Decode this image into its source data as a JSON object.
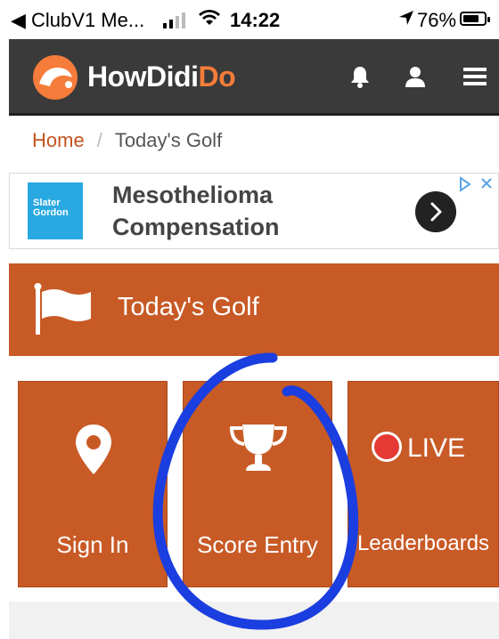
{
  "statusbar": {
    "back_app": "◀ ClubV1 Me...",
    "time": "14:22",
    "battery_percent": "76%",
    "battery_level": 0.76
  },
  "navbar": {
    "brand_left": "HowDidi",
    "brand_right": "Do"
  },
  "breadcrumb": {
    "home": "Home",
    "separator": "/",
    "current": "Today's Golf"
  },
  "ad": {
    "advertiser_logo_text": "Slater Gordon",
    "title": "Mesothelioma Compensation"
  },
  "section": {
    "title": "Today's Golf"
  },
  "tiles": [
    {
      "label": "Sign In",
      "icon": "map-pin-icon"
    },
    {
      "label": "Score Entry",
      "icon": "trophy-icon"
    },
    {
      "label": "Leaderboards",
      "icon": "live-indicator",
      "badge": "LIVE"
    }
  ],
  "colors": {
    "brand_orange": "#c85a26",
    "navbar": "#3a3a3a",
    "annotation_blue": "#1b3ee0"
  }
}
